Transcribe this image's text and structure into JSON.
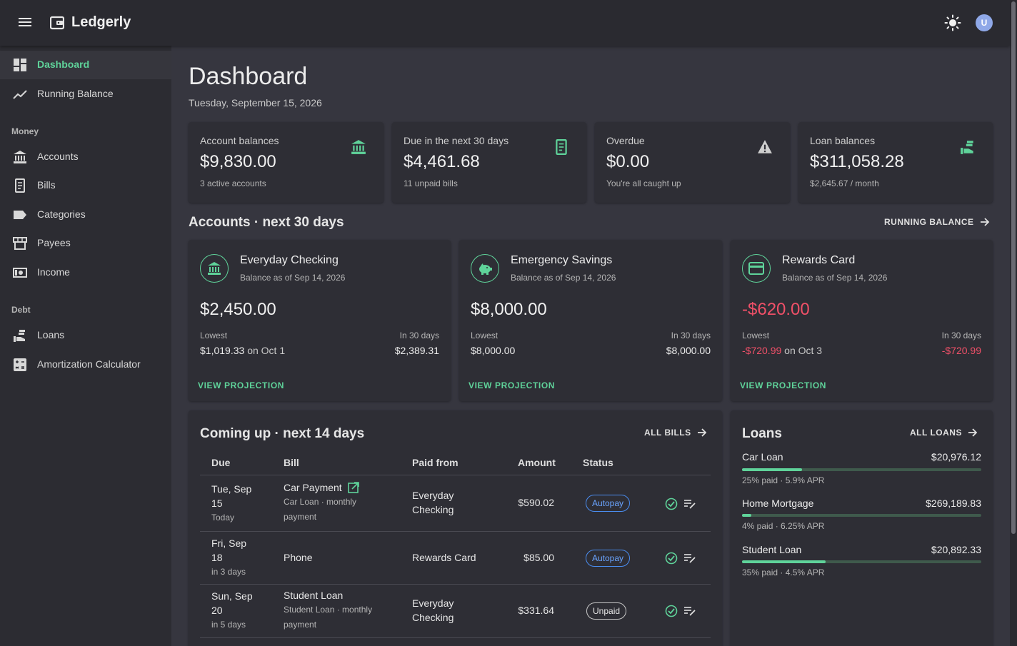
{
  "app": {
    "name": "Ledgerly",
    "avatar_initial": "U"
  },
  "sidebar": {
    "top_items": [
      {
        "label": "Dashboard",
        "icon": "dashboard-icon",
        "active": true
      },
      {
        "label": "Running Balance",
        "icon": "trending-line-icon",
        "active": false
      }
    ],
    "money_heading": "Money",
    "money_items": [
      {
        "label": "Accounts",
        "icon": "bank-icon"
      },
      {
        "label": "Bills",
        "icon": "receipt-icon"
      },
      {
        "label": "Categories",
        "icon": "label-icon"
      },
      {
        "label": "Payees",
        "icon": "store-icon"
      },
      {
        "label": "Income",
        "icon": "cash-icon"
      }
    ],
    "debt_heading": "Debt",
    "debt_items": [
      {
        "label": "Loans",
        "icon": "hand-coins-icon"
      },
      {
        "label": "Amortization Calculator",
        "icon": "calculator-icon"
      }
    ]
  },
  "page": {
    "title": "Dashboard",
    "date": "Tuesday, September 15, 2026"
  },
  "stats": [
    {
      "title": "Account balances",
      "value": "$9,830.00",
      "sub": "3 active accounts",
      "icon": "bank-icon"
    },
    {
      "title": "Due in the next 30 days",
      "value": "$4,461.68",
      "sub": "11 unpaid bills",
      "icon": "receipt-icon"
    },
    {
      "title": "Overdue",
      "value": "$0.00",
      "sub": "You're all caught up",
      "icon": "warning-icon"
    },
    {
      "title": "Loan balances",
      "value": "$311,058.28",
      "sub": "$2,645.67 / month",
      "icon": "hand-coins-icon"
    }
  ],
  "accounts_section": {
    "title": "Accounts · next 30 days",
    "link": "RUNNING BALANCE"
  },
  "accounts": [
    {
      "name": "Everyday Checking",
      "as_of": "Balance as of Sep 14, 2026",
      "balance": "$2,450.00",
      "lowest_label": "Lowest",
      "lowest_value": "$1,019.33",
      "lowest_on": "on Oct 1",
      "in30_label": "In 30 days",
      "in30_value": "$2,389.31",
      "action": "VIEW PROJECTION",
      "icon": "bank-icon",
      "negative": false
    },
    {
      "name": "Emergency Savings",
      "as_of": "Balance as of Sep 14, 2026",
      "balance": "$8,000.00",
      "lowest_label": "Lowest",
      "lowest_value": "$8,000.00",
      "lowest_on": "",
      "in30_label": "In 30 days",
      "in30_value": "$8,000.00",
      "action": "VIEW PROJECTION",
      "icon": "piggy-bank-icon",
      "negative": false
    },
    {
      "name": "Rewards Card",
      "as_of": "Balance as of Sep 14, 2026",
      "balance": "-$620.00",
      "lowest_label": "Lowest",
      "lowest_value": "-$720.99",
      "lowest_on": "on Oct 3",
      "in30_label": "In 30 days",
      "in30_value": "-$720.99",
      "action": "VIEW PROJECTION",
      "icon": "credit-card-icon",
      "negative": true
    }
  ],
  "bills_section": {
    "title": "Coming up · next 14 days",
    "link": "ALL BILLS",
    "headers": {
      "due": "Due",
      "bill": "Bill",
      "paid_from": "Paid from",
      "amount": "Amount",
      "status": "Status"
    },
    "rows": [
      {
        "due1": "Tue, Sep",
        "due2": "15",
        "rel": "Today",
        "bill": "Car Payment",
        "sub1": "Car Loan · monthly",
        "sub2": "payment",
        "paid1": "Everyday",
        "paid2": "Checking",
        "amount": "$590.02",
        "status": "Autopay"
      },
      {
        "due1": "Fri, Sep",
        "due2": "18",
        "rel": "in 3 days",
        "bill": "Phone",
        "sub1": "",
        "sub2": "",
        "paid1": "Rewards Card",
        "paid2": "",
        "amount": "$85.00",
        "status": "Autopay"
      },
      {
        "due1": "Sun, Sep",
        "due2": "20",
        "rel": "in 5 days",
        "bill": "Student Loan",
        "sub1": "Student Loan · monthly",
        "sub2": "payment",
        "paid1": "Everyday",
        "paid2": "Checking",
        "amount": "$331.64",
        "status": "Unpaid"
      }
    ]
  },
  "loans_section": {
    "title": "Loans",
    "link": "ALL LOANS",
    "loans": [
      {
        "name": "Car Loan",
        "balance": "$20,976.12",
        "meta": "25% paid · 5.9% APR",
        "paid_fraction": 0.25
      },
      {
        "name": "Home Mortgage",
        "balance": "$269,189.83",
        "meta": "4% paid · 6.25% APR",
        "paid_fraction": 0.04
      },
      {
        "name": "Student Loan",
        "balance": "$20,892.33",
        "meta": "35% paid · 4.5% APR",
        "paid_fraction": 0.35
      }
    ]
  },
  "colors": {
    "accent": "#5fd39a",
    "negative": "#f05068",
    "autopay": "#4a8df0"
  }
}
